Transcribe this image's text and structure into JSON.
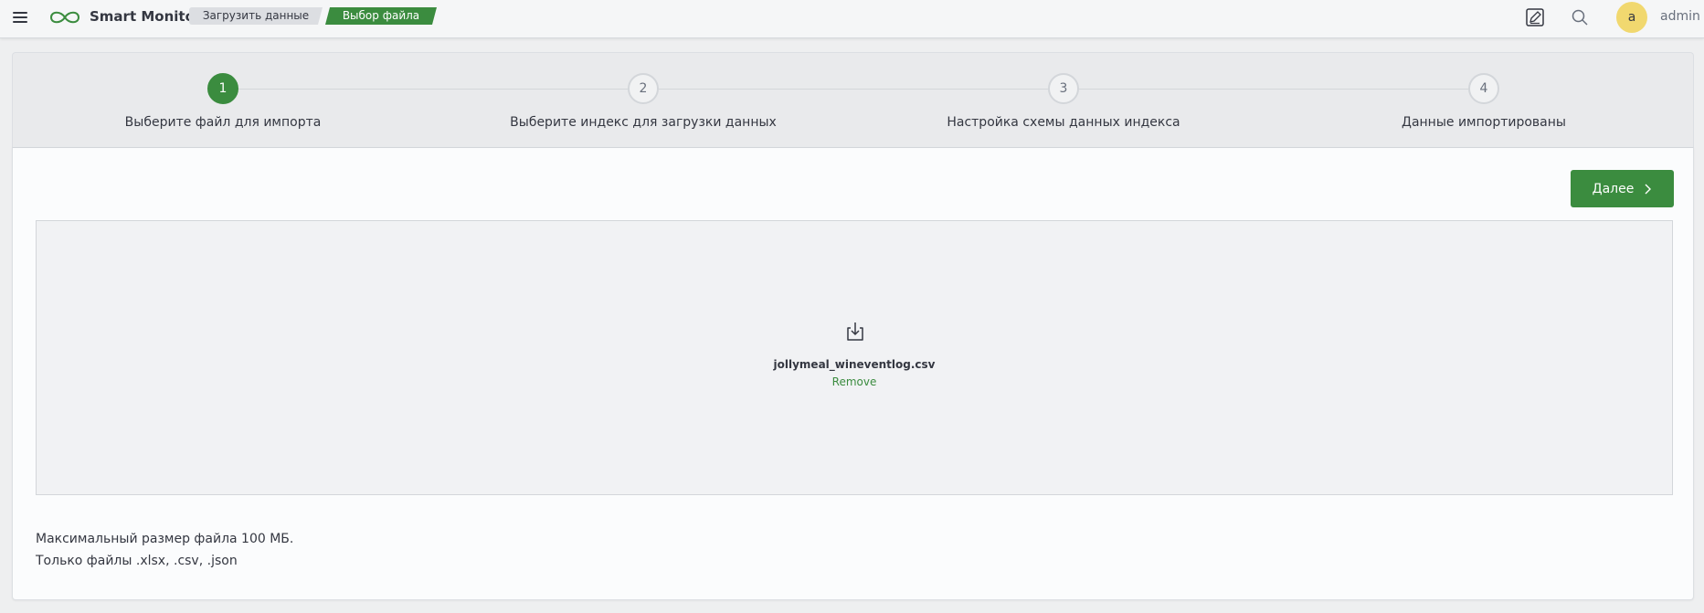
{
  "header": {
    "app_name": "Smart Monitor",
    "breadcrumbs": [
      "Загрузить данные",
      "Выбор файла"
    ],
    "user": {
      "avatar_letter": "a",
      "name": "admin"
    },
    "icons": [
      "menu-icon",
      "infinity-logo-icon",
      "edit-note-icon",
      "search-icon"
    ]
  },
  "stepper": {
    "active_step": 1,
    "steps": [
      {
        "number": "1",
        "title": "Выберите файл для импорта"
      },
      {
        "number": "2",
        "title": "Выберите индекс для загрузки данных"
      },
      {
        "number": "3",
        "title": "Настройка схемы данных индекса"
      },
      {
        "number": "4",
        "title": "Данные импортированы"
      }
    ]
  },
  "main": {
    "next_button": "Далее",
    "dropzone": {
      "file_name": "jollymeal_wineventlog.csv",
      "remove_label": "Remove"
    },
    "hints": [
      "Максимальный размер файла 100 МБ.",
      "Только файлы .xlsx, .csv, .json"
    ]
  },
  "colors": {
    "accent": "#3b8c3f",
    "avatar": "#f1d86f",
    "background": "#eeeff0"
  }
}
